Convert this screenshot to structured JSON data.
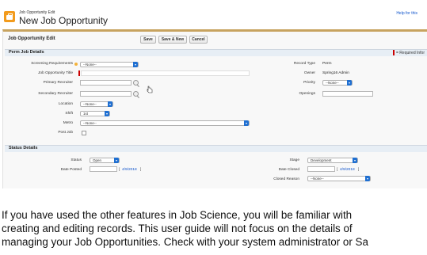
{
  "header": {
    "subtitle": "Job Opportunity Edit",
    "title": "New Job Opportunity",
    "help_link": "Help for this"
  },
  "page_block": {
    "title": "Job Opportunity Edit",
    "buttons": {
      "save": "Save",
      "save_new": "Save & New",
      "cancel": "Cancel"
    }
  },
  "perm_section": {
    "title": "Perm Job Details",
    "required_info": "= Required Infor",
    "fields": {
      "screening_requirements": {
        "label": "Screening Requirements",
        "value": "--None--"
      },
      "job_opportunity_title": {
        "label": "Job Opportunity Title",
        "value": ""
      },
      "primary_recruiter": {
        "label": "Primary Recruiter",
        "value": ""
      },
      "secondary_recruiter": {
        "label": "Secondary Recruiter",
        "value": ""
      },
      "location": {
        "label": "Location",
        "value": "--None--"
      },
      "shift": {
        "label": "Shift",
        "value": "1st"
      },
      "metro": {
        "label": "Metro",
        "value": "--None--"
      },
      "post_job": {
        "label": "Post Job"
      },
      "record_type": {
        "label": "Record Type",
        "value": "Perm"
      },
      "owner": {
        "label": "Owner",
        "value": "Spring16 Admin"
      },
      "priority": {
        "label": "Priority",
        "value": "--None--"
      },
      "openings": {
        "label": "Openings",
        "value": ""
      }
    }
  },
  "status_section": {
    "title": "Status Details",
    "fields": {
      "status": {
        "label": "Status",
        "value": "Open"
      },
      "date_posted": {
        "label": "Date Posted",
        "value": "",
        "today": "4/9/2018"
      },
      "stage": {
        "label": "Stage",
        "value": "Development"
      },
      "date_closed": {
        "label": "Date Closed",
        "value": "",
        "today": "4/9/2018"
      },
      "closed_reason": {
        "label": "Closed Reason",
        "value": "--None--"
      }
    }
  },
  "description": {
    "line1": "If you have used the other features in Job Science, you will be familiar with",
    "line2": "creating and editing records. This user guide will not focus on the details of",
    "line3": "managing your Job Opportunities. Check with your system administrator or Sa"
  },
  "colors": {
    "accent_bar": "#c7a35f",
    "section_bg": "#e7eef5",
    "select_arrow": "#1f6fd1",
    "required": "#cc0000",
    "link": "#1155cc",
    "app_icon": "#f29b1d"
  }
}
